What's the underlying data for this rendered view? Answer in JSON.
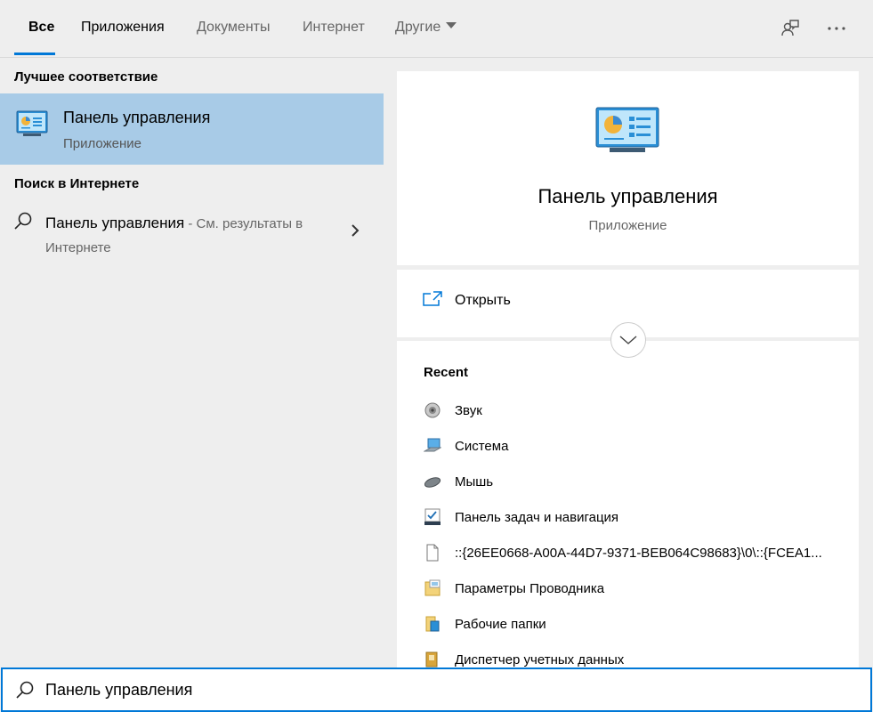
{
  "tabs": [
    {
      "label": "Все",
      "active": true
    },
    {
      "label": "Приложения",
      "active": false
    },
    {
      "label": "Документы",
      "active": false
    },
    {
      "label": "Интернет",
      "active": false
    },
    {
      "label": "Другие",
      "active": false
    }
  ],
  "top_icons": [
    "feedback-icon",
    "more-options-icon"
  ],
  "left": {
    "best_match_title": "Лучшее соответствие",
    "best_match": {
      "title": "Панель управления",
      "subtitle": "Приложение",
      "icon": "control-panel-icon"
    },
    "web_title": "Поиск в Интернете",
    "web_result": {
      "query": "Панель управления",
      "hint": " - См. результаты в Интернете"
    }
  },
  "preview": {
    "app_title": "Панель управления",
    "app_subtitle": "Приложение",
    "open_label": "Открыть",
    "recent_title": "Recent",
    "recent_items": [
      {
        "label": "Звук",
        "icon": "speaker-icon"
      },
      {
        "label": "Система",
        "icon": "computer-icon"
      },
      {
        "label": "Мышь",
        "icon": "mouse-icon"
      },
      {
        "label": "Панель задач и навигация",
        "icon": "taskbar-icon"
      },
      {
        "label": "::{26EE0668-A00A-44D7-9371-BEB064C98683}\\0\\::{FCEA1...",
        "icon": "file-icon"
      },
      {
        "label": "Параметры Проводника",
        "icon": "folder-options-icon"
      },
      {
        "label": "Рабочие папки",
        "icon": "work-folders-icon"
      },
      {
        "label": "Диспетчер учетных данных",
        "icon": "credential-manager-icon"
      }
    ]
  },
  "search": {
    "value": "Панель управления"
  },
  "colors": {
    "accent": "#0078d7",
    "selected_bg": "#a8cbe7",
    "panel_bg": "#eeeeee"
  }
}
